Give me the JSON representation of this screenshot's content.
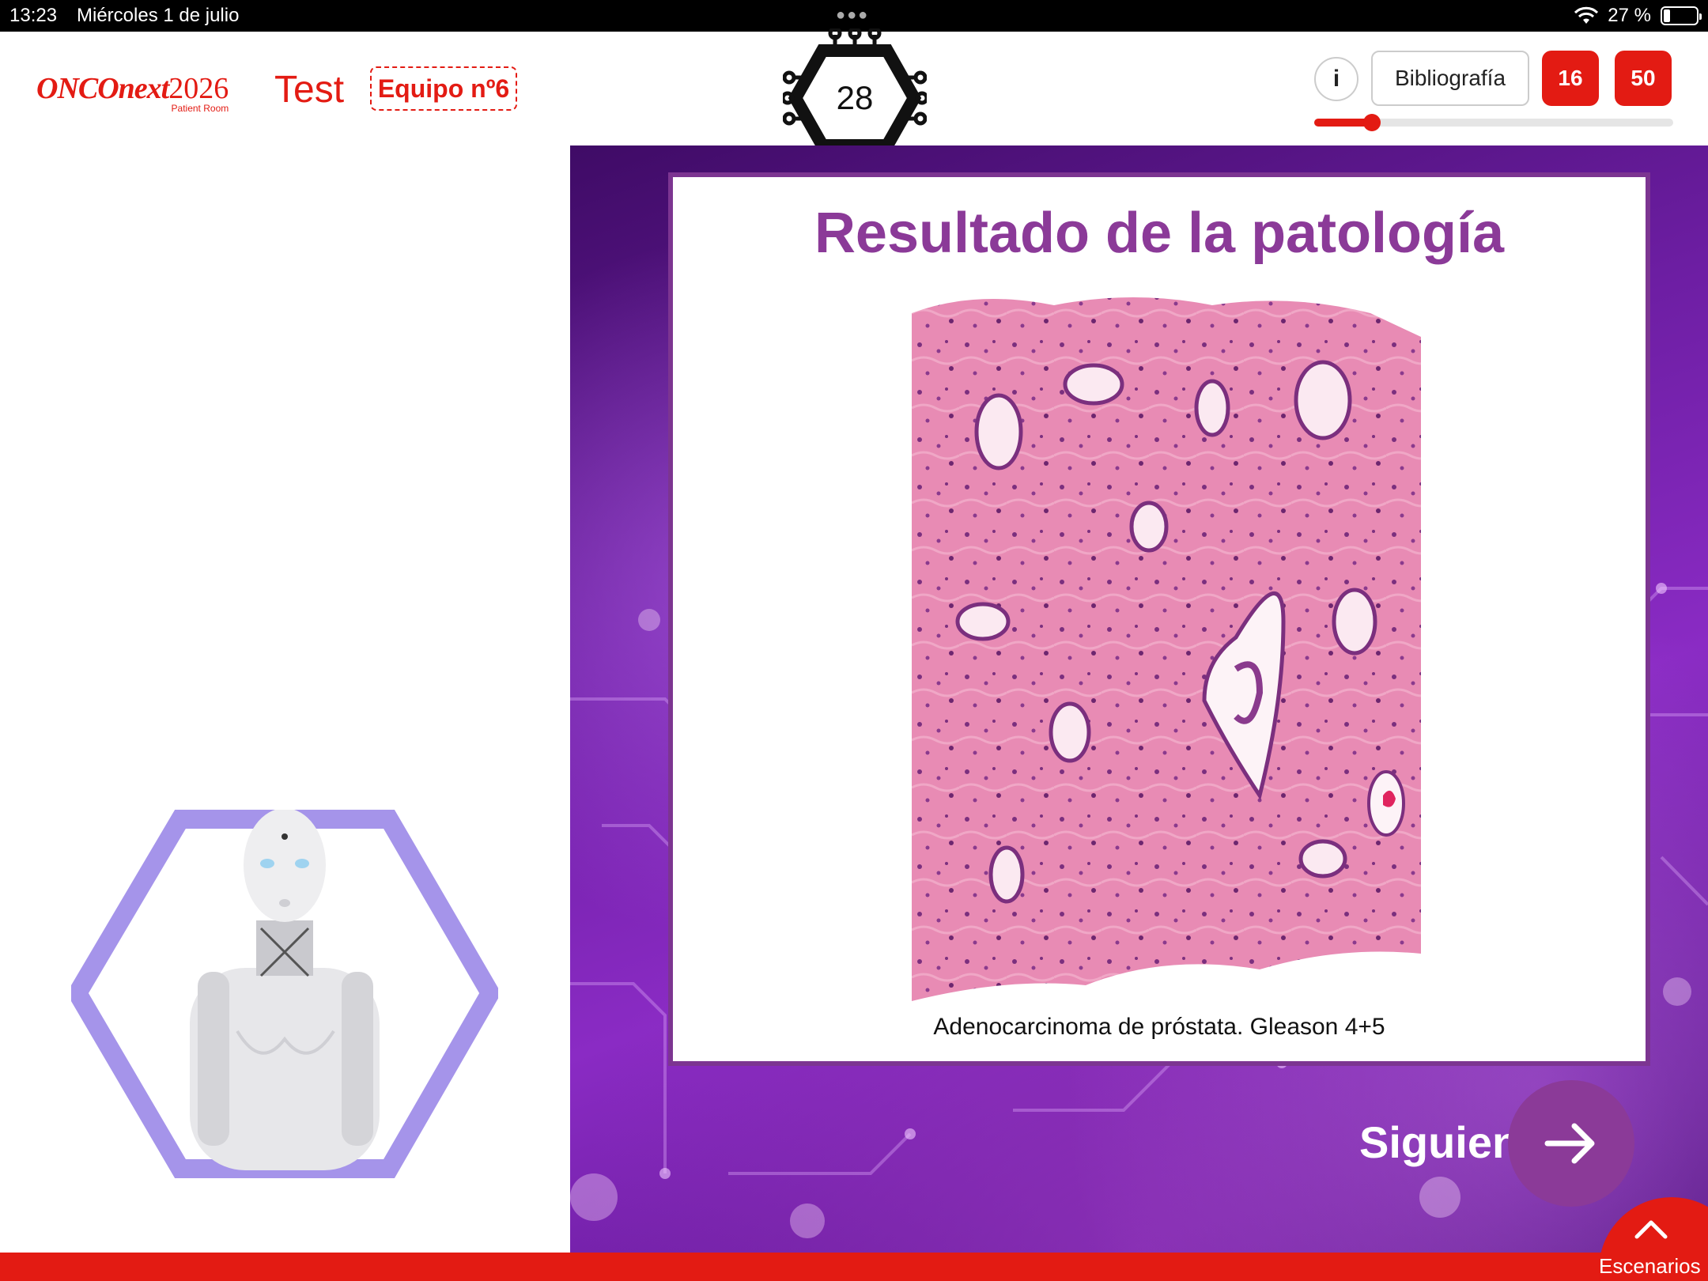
{
  "status_bar": {
    "time": "13:23",
    "date": "Miércoles 1 de julio",
    "battery": "27 %",
    "battery_level": 0.27
  },
  "header": {
    "logo_brand": "ONCOnext",
    "logo_year": "2026",
    "logo_sub": "Patient Room",
    "mode": "Test",
    "team": "Equipo nº6",
    "counter": "28",
    "info_label": "i",
    "bibliography_label": "Bibliografía",
    "score_1": "16",
    "score_2": "50",
    "progress": 0.16
  },
  "card": {
    "title": "Resultado de la patología",
    "caption": "Adenocarcinoma de próstata. Gleason 4+5"
  },
  "navigation": {
    "next_label": "Siguiente",
    "scenarios_label": "Escenarios"
  },
  "colors": {
    "brand_red": "#e31b13",
    "purple": "#8b3a98",
    "avatar_frame": "#a594ea"
  },
  "icons": [
    "wifi-icon",
    "battery-icon",
    "arrow-right-icon",
    "chevron-up-icon"
  ]
}
